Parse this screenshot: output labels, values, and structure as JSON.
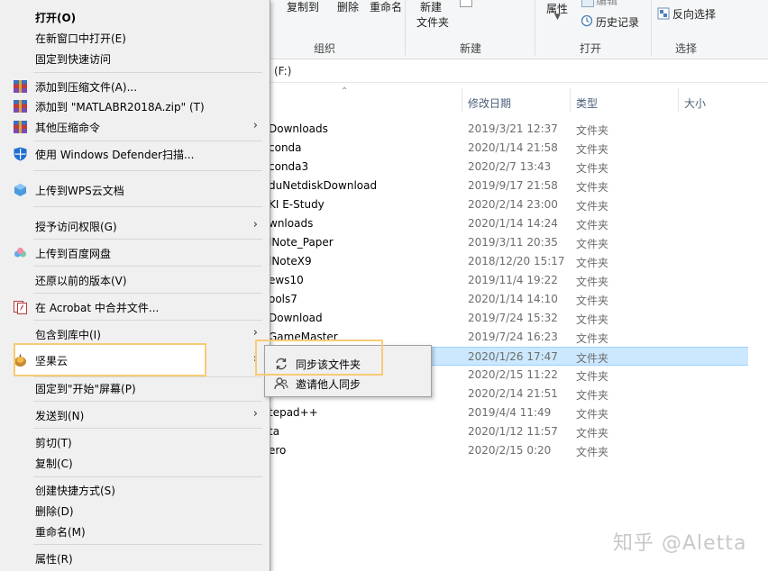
{
  "ribbon": {
    "items": [
      {
        "id": "copy_to",
        "label": "复制到"
      },
      {
        "id": "delete",
        "label": "删除"
      },
      {
        "id": "rename",
        "label": "重命名"
      },
      {
        "id": "new_folder_1",
        "label": "新建"
      },
      {
        "id": "new_folder_2",
        "label": "文件夹"
      },
      {
        "id": "properties",
        "label": "属性"
      },
      {
        "id": "edit",
        "label": "编辑"
      },
      {
        "id": "history",
        "label": "历史记录"
      },
      {
        "id": "invert_select",
        "label": "反向选择"
      }
    ],
    "groups": {
      "organize": "组织",
      "new": "新建",
      "open": "打开",
      "select": "选择"
    }
  },
  "address": {
    "path": "(F:)"
  },
  "columns": {
    "date": "修改日期",
    "type": "类型",
    "size": "大小"
  },
  "files": [
    {
      "name": "Downloads",
      "date": "2019/3/21 12:37",
      "type": "文件夹"
    },
    {
      "name": "conda",
      "date": "2020/1/14 21:58",
      "type": "文件夹"
    },
    {
      "name": "conda3",
      "date": "2020/2/7 13:43",
      "type": "文件夹"
    },
    {
      "name": "duNetdiskDownload",
      "date": "2019/9/17 21:58",
      "type": "文件夹"
    },
    {
      "name": "KI E-Study",
      "date": "2020/2/14 23:00",
      "type": "文件夹"
    },
    {
      "name": "wnloads",
      "date": "2020/1/14 14:24",
      "type": "文件夹"
    },
    {
      "name": "lNote_Paper",
      "date": "2019/3/11 20:35",
      "type": "文件夹"
    },
    {
      "name": "lNoteX9",
      "date": "2018/12/20 15:17",
      "type": "文件夹"
    },
    {
      "name": "ews10",
      "date": "2019/11/4 19:22",
      "type": "文件夹"
    },
    {
      "name": "ools7",
      "date": "2020/1/14 14:10",
      "type": "文件夹"
    },
    {
      "name": "Download",
      "date": "2019/7/24 15:32",
      "type": "文件夹"
    },
    {
      "name": "GameMaster",
      "date": "2019/7/24 16:23",
      "type": "文件夹"
    },
    {
      "name": "",
      "date": "2020/1/26 17:47",
      "type": "文件夹",
      "selected": true
    },
    {
      "name": "",
      "date": "2020/2/15 11:22",
      "type": "文件夹"
    },
    {
      "name": "",
      "date": "2020/2/14 21:51",
      "type": "文件夹"
    },
    {
      "name": "tepad++",
      "date": "2019/4/4 11:49",
      "type": "文件夹"
    },
    {
      "name": "ta",
      "date": "2020/1/12 11:57",
      "type": "文件夹"
    },
    {
      "name": "ero",
      "date": "2020/2/15 0:20",
      "type": "文件夹"
    }
  ],
  "context_menu": {
    "open": "打开(O)",
    "open_new_window": "在新窗口中打开(E)",
    "pin_quick_access": "固定到快速访问",
    "add_archive": "添加到压缩文件(A)...",
    "add_zip": "添加到 \"MATLABR2018A.zip\" (T)",
    "other_compress": "其他压缩命令",
    "defender": "使用 Windows Defender扫描...",
    "wps_upload": "上传到WPS云文档",
    "grant_access": "授予访问权限(G)",
    "baidu_upload": "上传到百度网盘",
    "restore_versions": "还原以前的版本(V)",
    "acrobat_merge": "在 Acrobat 中合并文件...",
    "include_library": "包含到库中(I)",
    "jianguoyun": "坚果云",
    "pin_start": "固定到\"开始\"屏幕(P)",
    "send_to": "发送到(N)",
    "cut": "剪切(T)",
    "copy": "复制(C)",
    "create_shortcut": "创建快捷方式(S)",
    "delete": "删除(D)",
    "rename": "重命名(M)",
    "properties": "属性(R)"
  },
  "submenu": {
    "sync_folder": "同步该文件夹",
    "invite_sync": "邀请他人同步"
  },
  "watermark": "知乎 @Aletta",
  "colors": {
    "selected_row": "#cce8ff",
    "highlight_box": "#f7cb76",
    "menu_bg": "#f0f0f0"
  }
}
